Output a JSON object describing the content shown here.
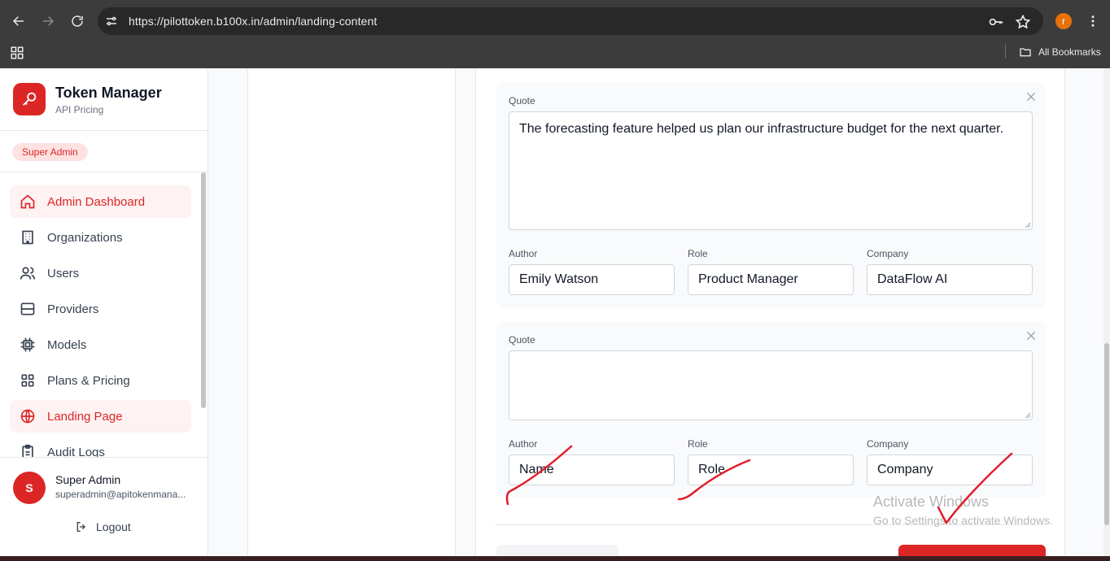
{
  "browser": {
    "url": "https://pilottoken.b100x.in/admin/landing-content",
    "profile_initial": "r",
    "bookmarks_label": "All Bookmarks",
    "icons": [
      "back-icon",
      "forward-icon",
      "reload-icon",
      "site-settings-icon",
      "password-key-icon",
      "star-icon",
      "kebab-menu-icon",
      "apps-grid-icon",
      "folder-icon"
    ]
  },
  "sidebar": {
    "brand_title": "Token Manager",
    "brand_subtitle": "API Pricing",
    "role_badge": "Super Admin",
    "items": [
      {
        "label": "Admin Dashboard",
        "icon": "home-icon",
        "active": true
      },
      {
        "label": "Organizations",
        "icon": "building-icon",
        "active": false
      },
      {
        "label": "Users",
        "icon": "users-icon",
        "active": false
      },
      {
        "label": "Providers",
        "icon": "server-icon",
        "active": false
      },
      {
        "label": "Models",
        "icon": "cpu-icon",
        "active": false
      },
      {
        "label": "Plans & Pricing",
        "icon": "grid-icon",
        "active": false
      },
      {
        "label": "Landing Page",
        "icon": "globe-icon",
        "active": true
      },
      {
        "label": "Audit Logs",
        "icon": "clipboard-icon",
        "active": false
      }
    ],
    "user": {
      "initial": "S",
      "name": "Super Admin",
      "email": "superadmin@apitokenmana..."
    },
    "logout_label": "Logout"
  },
  "testimonials": [
    {
      "quote_label": "Quote",
      "quote": "The forecasting feature helped us plan our infrastructure budget for the next quarter.",
      "author_label": "Author",
      "author": "Emily Watson",
      "role_label": "Role",
      "role": "Product Manager",
      "company_label": "Company",
      "company": "DataFlow AI"
    },
    {
      "quote_label": "Quote",
      "quote": "",
      "author_label": "Author",
      "author": "Name",
      "role_label": "Role",
      "role": "Role",
      "company_label": "Company",
      "company": "Company"
    }
  ],
  "watermark": {
    "line1": "Activate Windows",
    "line2": "Go to Settings to activate Windows."
  },
  "colors": {
    "accent": "#dc2626",
    "accent_soft": "#fef2f2",
    "annotation_ink": "#e11d2a"
  }
}
